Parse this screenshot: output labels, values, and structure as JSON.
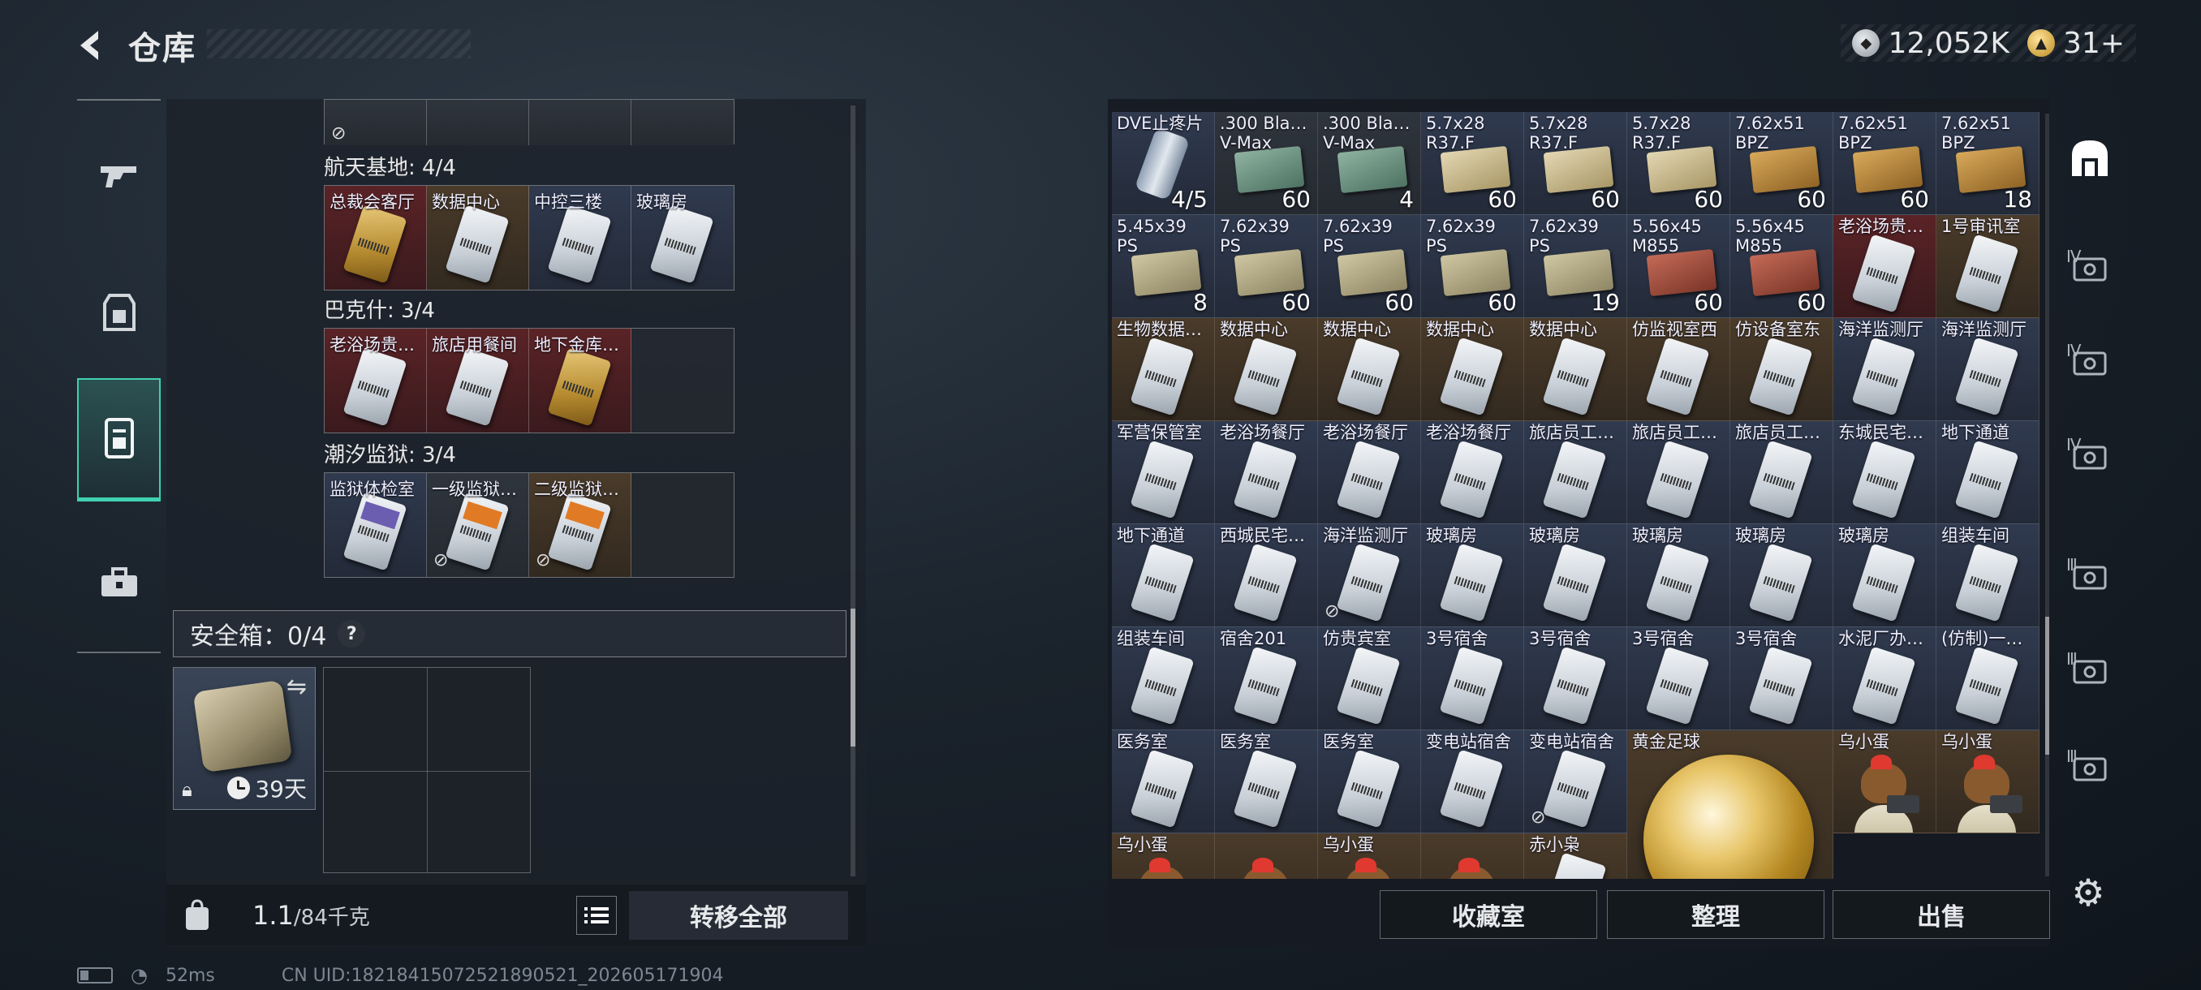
{
  "header": {
    "title": "仓库"
  },
  "currency": {
    "silver": "12,052K",
    "gold": "31+"
  },
  "left_nav": [
    {
      "name": "weapons-tab",
      "icon": "gun-icon"
    },
    {
      "name": "equipment-tab",
      "icon": "armor-icon"
    },
    {
      "name": "keycards-tab",
      "icon": "keycard-icon",
      "active": true
    },
    {
      "name": "items-tab",
      "icon": "toolbox-icon"
    }
  ],
  "storage": {
    "groups": [
      {
        "label": "航天基地: 4/4",
        "slots": [
          {
            "label": "总裁会客厅",
            "bg": "red",
            "card": "gold"
          },
          {
            "label": "数据中心",
            "bg": "brown",
            "card": "white"
          },
          {
            "label": "中控三楼",
            "bg": "blue",
            "card": "white"
          },
          {
            "label": "玻璃房",
            "bg": "blue",
            "card": "white"
          }
        ]
      },
      {
        "label": "巴克什: 3/4",
        "slots": [
          {
            "label": "老浴场贵…",
            "bg": "red",
            "card": "white"
          },
          {
            "label": "旅店用餐间",
            "bg": "red",
            "card": "white"
          },
          {
            "label": "地下金库…",
            "bg": "red",
            "card": "gold"
          },
          {
            "label": "",
            "bg": "empty",
            "card": ""
          }
        ]
      },
      {
        "label": "潮汐监狱: 3/4",
        "slots": [
          {
            "label": "监狱体检室",
            "bg": "blue",
            "card": "purple"
          },
          {
            "label": "一级监狱…",
            "bg": "gray",
            "card": "orange",
            "no_trade": true
          },
          {
            "label": "二级监狱…",
            "bg": "brown",
            "card": "orange",
            "no_trade": true
          },
          {
            "label": "",
            "bg": "empty",
            "card": ""
          }
        ]
      }
    ],
    "no_trade_icon": "⊘"
  },
  "safe_box": {
    "label": "安全箱：0/4",
    "help": "?",
    "time": "39天"
  },
  "bottom_left": {
    "weight_value": "1.1",
    "weight_max": "/84千克",
    "transfer_all": "转移全部"
  },
  "inventory": {
    "cells": [
      {
        "label": "DVE止疼片",
        "count": "4/5",
        "kind": "tube",
        "bg": "blue"
      },
      {
        "label": ".300 Bla…\nV-Max",
        "count": "60",
        "kind": "ammo",
        "ammo": "green",
        "bg": "gray"
      },
      {
        "label": ".300 Bla…\nV-Max",
        "count": "4",
        "kind": "ammo",
        "ammo": "green",
        "bg": "gray"
      },
      {
        "label": "5.7x28\nR37.F",
        "count": "60",
        "kind": "ammo",
        "ammo": "beige",
        "bg": "blue"
      },
      {
        "label": "5.7x28\nR37.F",
        "count": "60",
        "kind": "ammo",
        "ammo": "beige",
        "bg": "blue"
      },
      {
        "label": "5.7x28\nR37.F",
        "count": "60",
        "kind": "ammo",
        "ammo": "beige",
        "bg": "blue"
      },
      {
        "label": "7.62x51\nBPZ",
        "count": "60",
        "kind": "ammo",
        "ammo": "wood",
        "bg": "blue"
      },
      {
        "label": "7.62x51\nBPZ",
        "count": "60",
        "kind": "ammo",
        "ammo": "wood",
        "bg": "blue"
      },
      {
        "label": "7.62x51\nBPZ",
        "count": "18",
        "kind": "ammo",
        "ammo": "wood",
        "bg": "blue"
      },
      {
        "label": "5.45x39\nPS",
        "count": "8",
        "kind": "ammo",
        "ammo": "olive",
        "bg": "blue"
      },
      {
        "label": "7.62x39\nPS",
        "count": "60",
        "kind": "ammo",
        "ammo": "olive",
        "bg": "blue"
      },
      {
        "label": "7.62x39\nPS",
        "count": "60",
        "kind": "ammo",
        "ammo": "olive",
        "bg": "blue"
      },
      {
        "label": "7.62x39\nPS",
        "count": "60",
        "kind": "ammo",
        "ammo": "olive",
        "bg": "blue"
      },
      {
        "label": "7.62x39\nPS",
        "count": "19",
        "kind": "ammo",
        "ammo": "olive",
        "bg": "blue"
      },
      {
        "label": "5.56x45\nM855",
        "count": "60",
        "kind": "ammo",
        "ammo": "red",
        "bg": "blue"
      },
      {
        "label": "5.56x45\nM855",
        "count": "60",
        "kind": "ammo",
        "ammo": "red",
        "bg": "blue"
      },
      {
        "label": "老浴场贵…",
        "count": "",
        "kind": "card",
        "card": "white",
        "bg": "red"
      },
      {
        "label": "1号审讯室",
        "count": "",
        "kind": "card",
        "card": "white",
        "bg": "brown"
      },
      {
        "label": "生物数据…",
        "count": "",
        "kind": "card",
        "card": "white",
        "bg": "brown"
      },
      {
        "label": "数据中心",
        "count": "",
        "kind": "card",
        "card": "white",
        "bg": "brown"
      },
      {
        "label": "数据中心",
        "count": "",
        "kind": "card",
        "card": "white",
        "bg": "brown"
      },
      {
        "label": "数据中心",
        "count": "",
        "kind": "card",
        "card": "white",
        "bg": "brown"
      },
      {
        "label": "数据中心",
        "count": "",
        "kind": "card",
        "card": "white",
        "bg": "brown"
      },
      {
        "label": "仿监视室西",
        "count": "",
        "kind": "card",
        "card": "white",
        "bg": "brown"
      },
      {
        "label": "仿设备室东",
        "count": "",
        "kind": "card",
        "card": "white",
        "bg": "brown"
      },
      {
        "label": "海洋监测厅",
        "count": "",
        "kind": "card",
        "card": "white",
        "bg": "blue"
      },
      {
        "label": "海洋监测厅",
        "count": "",
        "kind": "card",
        "card": "white",
        "bg": "blue"
      },
      {
        "label": "军营保管室",
        "count": "",
        "kind": "card",
        "card": "white",
        "bg": "blue"
      },
      {
        "label": "老浴场餐厅",
        "count": "",
        "kind": "card",
        "card": "white",
        "bg": "blue"
      },
      {
        "label": "老浴场餐厅",
        "count": "",
        "kind": "card",
        "card": "white",
        "bg": "blue"
      },
      {
        "label": "老浴场餐厅",
        "count": "",
        "kind": "card",
        "card": "white",
        "bg": "blue"
      },
      {
        "label": "旅店员工…",
        "count": "",
        "kind": "card",
        "card": "white",
        "bg": "blue"
      },
      {
        "label": "旅店员工…",
        "count": "",
        "kind": "card",
        "card": "white",
        "bg": "blue"
      },
      {
        "label": "旅店员工…",
        "count": "",
        "kind": "card",
        "card": "white",
        "bg": "blue"
      },
      {
        "label": "东城民宅…",
        "count": "",
        "kind": "card",
        "card": "white",
        "bg": "blue"
      },
      {
        "label": "地下通道",
        "count": "",
        "kind": "card",
        "card": "white",
        "bg": "blue"
      },
      {
        "label": "地下通道",
        "count": "",
        "kind": "card",
        "card": "white",
        "bg": "blue"
      },
      {
        "label": "西城民宅…",
        "count": "",
        "kind": "card",
        "card": "white",
        "bg": "blue"
      },
      {
        "label": "海洋监测厅",
        "count": "",
        "kind": "card",
        "card": "white",
        "bg": "blue",
        "no_trade": true
      },
      {
        "label": "玻璃房",
        "count": "",
        "kind": "card",
        "card": "white",
        "bg": "blue"
      },
      {
        "label": "玻璃房",
        "count": "",
        "kind": "card",
        "card": "white",
        "bg": "blue"
      },
      {
        "label": "玻璃房",
        "count": "",
        "kind": "card",
        "card": "white",
        "bg": "blue"
      },
      {
        "label": "玻璃房",
        "count": "",
        "kind": "card",
        "card": "white",
        "bg": "blue"
      },
      {
        "label": "玻璃房",
        "count": "",
        "kind": "card",
        "card": "white",
        "bg": "blue"
      },
      {
        "label": "组装车间",
        "count": "",
        "kind": "card",
        "card": "white",
        "bg": "blue"
      },
      {
        "label": "组装车间",
        "count": "",
        "kind": "card",
        "card": "white",
        "bg": "blue"
      },
      {
        "label": "宿舍201",
        "count": "",
        "kind": "card",
        "card": "white",
        "bg": "blue"
      },
      {
        "label": "仿贵宾室",
        "count": "",
        "kind": "card",
        "card": "white",
        "bg": "blue"
      },
      {
        "label": "3号宿舍",
        "count": "",
        "kind": "card",
        "card": "white",
        "bg": "blue"
      },
      {
        "label": "3号宿舍",
        "count": "",
        "kind": "card",
        "card": "white",
        "bg": "blue"
      },
      {
        "label": "3号宿舍",
        "count": "",
        "kind": "card",
        "card": "white",
        "bg": "blue"
      },
      {
        "label": "3号宿舍",
        "count": "",
        "kind": "card",
        "card": "white",
        "bg": "blue"
      },
      {
        "label": "水泥厂办…",
        "count": "",
        "kind": "card",
        "card": "white",
        "bg": "blue"
      },
      {
        "label": "(仿制)一…",
        "count": "",
        "kind": "card",
        "card": "white",
        "bg": "blue"
      },
      {
        "label": "医务室",
        "count": "",
        "kind": "card",
        "card": "white",
        "bg": "blue"
      },
      {
        "label": "医务室",
        "count": "",
        "kind": "card",
        "card": "white",
        "bg": "blue"
      },
      {
        "label": "医务室",
        "count": "",
        "kind": "card",
        "card": "white",
        "bg": "blue"
      },
      {
        "label": "变电站宿舍",
        "count": "",
        "kind": "card",
        "card": "white",
        "bg": "blue"
      },
      {
        "label": "变电站宿舍",
        "count": "",
        "kind": "card",
        "card": "white",
        "bg": "blue",
        "no_trade": true
      },
      {
        "label": "黄金足球",
        "count": "",
        "kind": "ball",
        "bg": "brown",
        "span": true
      },
      {
        "label": "乌小蛋",
        "count": "",
        "kind": "mascot",
        "bg": "brown"
      },
      {
        "label": "乌小蛋",
        "count": "",
        "kind": "mascot",
        "bg": "brown"
      },
      {
        "label": "乌小蛋",
        "count": "",
        "kind": "mascot",
        "bg": "brown"
      },
      {
        "label": "",
        "count": "",
        "kind": "mascot",
        "bg": "brown"
      },
      {
        "label": "乌小蛋",
        "count": "",
        "kind": "mascot",
        "bg": "brown"
      },
      {
        "label": "",
        "count": "",
        "kind": "mascot",
        "bg": "brown"
      },
      {
        "label": "赤小枭",
        "count": "",
        "kind": "card",
        "card": "white",
        "bg": "brown"
      }
    ]
  },
  "right_rail": [
    {
      "name": "all-filter",
      "icon": "arch-icon",
      "text": "",
      "active": true
    },
    {
      "name": "tier4-filter-1",
      "icon": "tier-icon",
      "text": "Ⅳ"
    },
    {
      "name": "tier4-filter-2",
      "icon": "tier-icon",
      "text": "Ⅳ"
    },
    {
      "name": "tier4-filter-3",
      "icon": "tier-icon",
      "text": "Ⅳ"
    },
    {
      "name": "tier3-filter-1",
      "icon": "tier-icon",
      "text": "Ⅲ"
    },
    {
      "name": "tier3-filter-2",
      "icon": "tier-icon",
      "text": "Ⅲ"
    },
    {
      "name": "tier3-filter-3",
      "icon": "tier-icon",
      "text": "Ⅲ"
    }
  ],
  "bottom_right": {
    "collection": "收藏室",
    "organize": "整理",
    "sell": "出售"
  },
  "status": {
    "ping": "52ms",
    "uid": "CN UID:18218415072521890521_202605171904"
  }
}
